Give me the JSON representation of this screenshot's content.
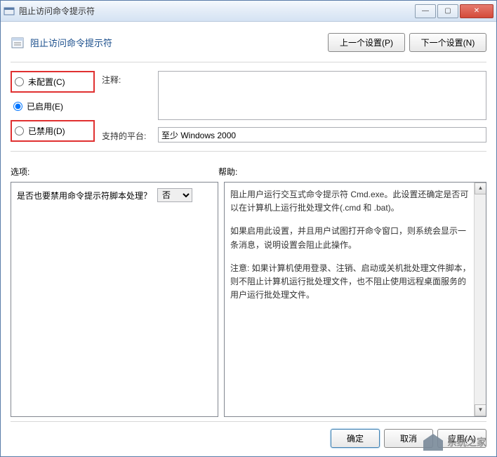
{
  "window": {
    "title": "阻止访问命令提示符"
  },
  "header": {
    "title": "阻止访问命令提示符",
    "prev_button": "上一个设置(P)",
    "next_button": "下一个设置(N)"
  },
  "radios": {
    "not_configured": "未配置(C)",
    "enabled": "已启用(E)",
    "disabled": "已禁用(D)"
  },
  "labels": {
    "comment": "注释:",
    "platform": "支持的平台:",
    "options": "选项:",
    "help": "帮助:"
  },
  "platform_value": "至少 Windows 2000",
  "options": {
    "question": "是否也要禁用命令提示符脚本处理？",
    "select_value": "否"
  },
  "help": {
    "p1": "阻止用户运行交互式命令提示符 Cmd.exe。此设置还确定是否可以在计算机上运行批处理文件(.cmd 和 .bat)。",
    "p2": "如果启用此设置，并且用户试图打开命令窗口，则系统会显示一条消息，说明设置会阻止此操作。",
    "p3": "注意: 如果计算机使用登录、注销、启动或关机批处理文件脚本，则不阻止计算机运行批处理文件，也不阻止使用远程桌面服务的用户运行批处理文件。"
  },
  "footer": {
    "ok": "确定",
    "cancel": "取消",
    "apply": "应用(A)"
  },
  "watermark": "系统之家"
}
